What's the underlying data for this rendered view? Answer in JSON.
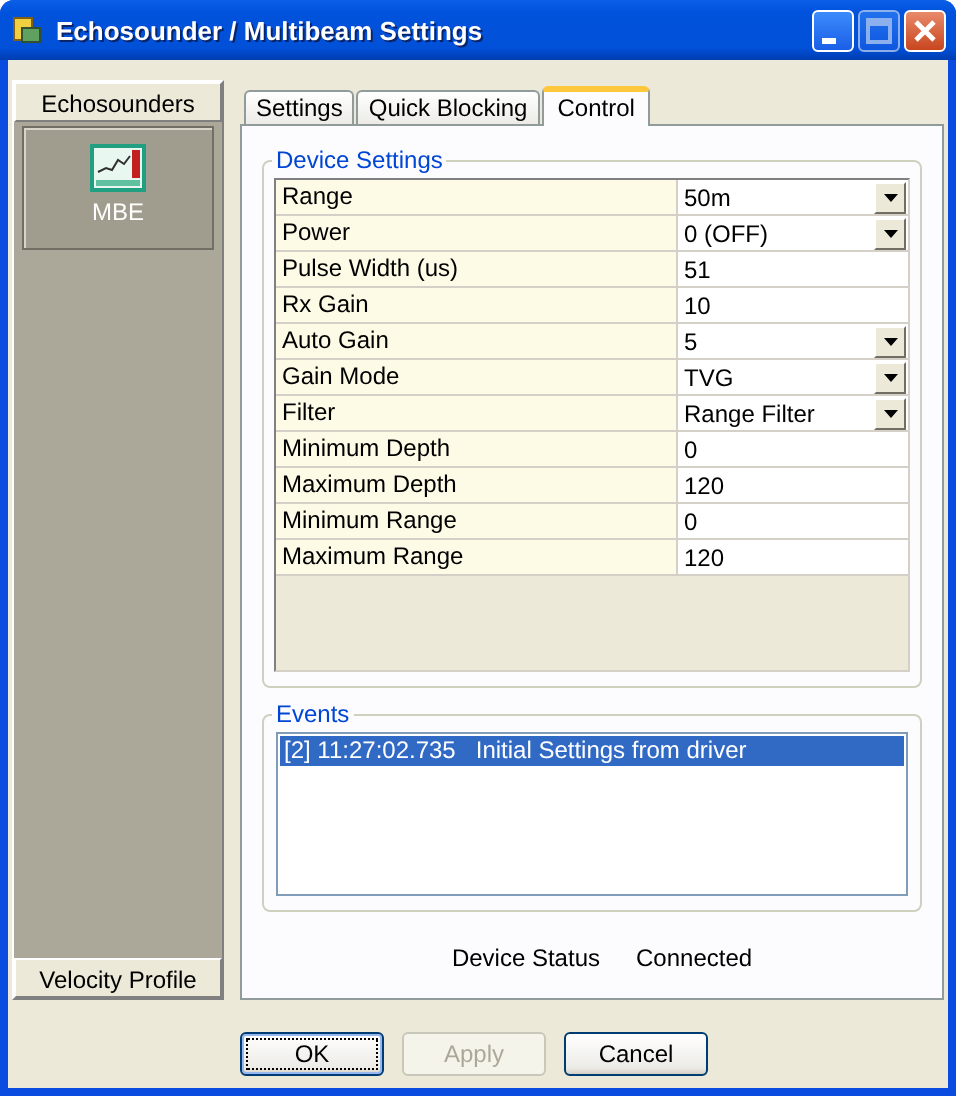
{
  "window": {
    "title": "Echosounder / Multibeam Settings",
    "controls": [
      {
        "kind": "minimize",
        "disabled": false
      },
      {
        "kind": "maximize",
        "disabled": true
      },
      {
        "kind": "close",
        "disabled": false
      }
    ]
  },
  "sidebar": {
    "header": "Echosounders",
    "items": [
      {
        "label": "MBE",
        "selected": true
      }
    ],
    "footer": "Velocity Profile"
  },
  "tabs": [
    {
      "label": "Settings",
      "selected": false
    },
    {
      "label": "Quick Blocking",
      "selected": false
    },
    {
      "label": "Control",
      "selected": true
    }
  ],
  "device_settings": {
    "title": "Device Settings",
    "rows": [
      {
        "name": "Range",
        "value": "50m",
        "kind": "dropdown"
      },
      {
        "name": "Power",
        "value": "0 (OFF)",
        "kind": "dropdown"
      },
      {
        "name": "Pulse Width (us)",
        "value": "51",
        "kind": "text"
      },
      {
        "name": "Rx Gain",
        "value": "10",
        "kind": "text"
      },
      {
        "name": "Auto Gain",
        "value": "5",
        "kind": "dropdown"
      },
      {
        "name": "Gain Mode",
        "value": "TVG",
        "kind": "dropdown"
      },
      {
        "name": "Filter",
        "value": "Range Filter",
        "kind": "dropdown"
      },
      {
        "name": "Minimum Depth",
        "value": "0",
        "kind": "text"
      },
      {
        "name": "Maximum Depth",
        "value": "120",
        "kind": "text"
      },
      {
        "name": "Minimum Range",
        "value": "0",
        "kind": "text"
      },
      {
        "name": "Maximum Range",
        "value": "120",
        "kind": "text"
      }
    ]
  },
  "events": {
    "title": "Events",
    "items": [
      {
        "text": "[2] 11:27:02.735   Initial Settings from driver",
        "selected": true
      }
    ]
  },
  "status": {
    "label": "Device Status",
    "value": "Connected"
  },
  "buttons": [
    {
      "label": "OK",
      "disabled": false,
      "default": true
    },
    {
      "label": "Apply",
      "disabled": true,
      "default": false
    },
    {
      "label": "Cancel",
      "disabled": false,
      "default": false
    }
  ]
}
